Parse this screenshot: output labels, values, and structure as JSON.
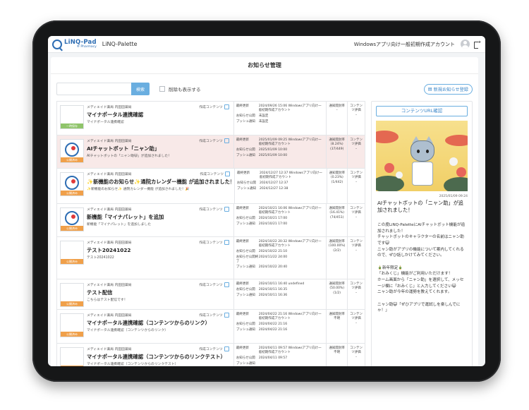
{
  "app": {
    "logo_main": "LiNQ-Pad",
    "logo_sub": "® Pharmacy",
    "name": "LiNQ-Palette",
    "account": "Windowsアプリ向け一般初期作成アカウント"
  },
  "page": {
    "title": "お知らせ管理",
    "search_button": "検索",
    "show_deleted_label": "削除も表示する",
    "new_button": "新規お知らせ登録"
  },
  "labels": {
    "content_type": "作成コンテンツ",
    "last_updated": "最終更新",
    "notice_public": "お知らせ公開",
    "push_notification": "プッシュ通知",
    "notice_end": "お知らせ公開終了",
    "read_rate": "通知開封率",
    "content_rating": "コンテンツ評価"
  },
  "notices": [
    {
      "pharmacy": "メディエイド薬局 内田田薬局",
      "title": "マイナポータル連携確認",
      "desc": "マイナポータル連携確認",
      "status": "一時保存",
      "status_color": "green",
      "has_logo": false,
      "updated": "2024/09/26 15:06 Windowsアプリ向け一般初期作成アカウント",
      "public": "未設定",
      "push": "未設定",
      "read_rate": "–",
      "rating": "–"
    },
    {
      "pharmacy": "メディエイド薬局 内田田薬局",
      "title": "AIチャットボット「ニャン助」",
      "desc": "AIチャットボットの「ニャン助😺」が追加されました！",
      "status": "公開済み",
      "status_color": "orange",
      "has_logo": true,
      "updated": "2025/01/09 09:25 Windowsアプリ向け一般初期作成アカウント",
      "public": "2025/01/09 10:00",
      "push": "2025/01/09 10:00",
      "read_rate": "(8.24%) (37/449)",
      "rating": "–"
    },
    {
      "pharmacy": "メディエイド薬局 内田田薬局",
      "title": "✨新機能のお知らせ✨通院カレンダー機能 が追加されました！",
      "desc": "✨新機能のお知らせ✨ 通院カレンダー機能 が追加されました！🎉",
      "status": "公開済み",
      "status_color": "orange",
      "has_logo": true,
      "updated": "2024/12/27 12:37 Windowsアプリ向け一般初期作成アカウント",
      "public": "2024/12/27 12:37",
      "push": "2024/12/27 12:38",
      "read_rate": "(0.23%) (1/442)",
      "rating": "–"
    },
    {
      "pharmacy": "メディエイド薬局 内田田薬局",
      "title": "新機能「マイナパレット」を追加",
      "desc": "新機能「マイナパレット」を追加しました",
      "status": "公開済み",
      "status_color": "orange",
      "has_logo": true,
      "updated": "2024/10/21 16:06 Windowsアプリ向け一般初期作成アカウント",
      "public": "2024/10/21 17:00",
      "push": "2024/10/21 17:00",
      "read_rate": "(16.41%) (74/451)",
      "rating": "–"
    },
    {
      "pharmacy": "メディエイド薬局 内田田薬局",
      "title": "テスト20241022",
      "desc": "テスト20241022",
      "status": "公開済み",
      "status_color": "orange",
      "has_logo": false,
      "updated": "2024/10/22 20:32 Windowsアプリ向け一般初期作成アカウント",
      "public": "2024/10/22 21:10",
      "end": "2024/11/22 24:00",
      "push": "2024/10/22 20:40",
      "read_rate": "(100.00%) (2/2)",
      "rating": "–"
    },
    {
      "pharmacy": "メディエイド薬局 内田田薬局",
      "title": "テスト配信",
      "desc": "こちらはテスト配信です！",
      "status": "公開済み",
      "status_color": "orange",
      "has_logo": false,
      "updated": "2024/10/11 16:40 undefined",
      "public": "2024/10/11 16:35",
      "push": "2024/10/11 16:36",
      "read_rate": "(50.00%) (1/2)",
      "rating": "–"
    },
    {
      "pharmacy": "メディエイド薬局 内田田薬局",
      "title": "マイナポータル連携確認（コンテンツからのリンク）",
      "desc": "マイナポータル連携確認（コンテンツからのリンク）",
      "status": "公開済み",
      "status_color": "orange",
      "has_logo": false,
      "updated": "2024/04/22 21:16 Windowsアプリ向け一般初期作成アカウント",
      "public": "2024/04/22 21:16",
      "push": "2024/04/22 21:16",
      "read_rate": "不明",
      "rating": "–"
    },
    {
      "pharmacy": "メディエイド薬局 内田田薬局",
      "title": "マイナポータル連携確認（コンテンツからのリンクテスト）",
      "desc": "マイナポータル連携確認（コンテンツからのリンクテスト）",
      "status": "公開済み",
      "status_color": "orange",
      "has_logo": false,
      "updated": "2024/04/11 09:57 Windowsアプリ向け一般初期作成アカウント",
      "public": "2024/04/11 09:57",
      "push": "",
      "read_rate": "不明",
      "rating": "–"
    }
  ],
  "preview": {
    "url_button": "コンテンツURL確認",
    "date": "2025/01/09 09:24",
    "title": "AIチャットボットの「ニャン助」が追加されました！",
    "body": "この度LiNQ-PaletteにAIチャットボット機能が追加されました！\nチャットボットのキャラクターの名前はニャン助です😺\nニャン助がアプリの機能について案内してくれるので、ぜひ話しかけてみてください。\n\n🎍新年限定🎍\n「おみくじ」機能がご利用いただけます！\nホーム画面から「ニャン助」を選択して、メッセージ欄に「おみくじ」と入力してください😺\nニャン助が今年の運勢を教えてくれます。\n\nニャン助😺「ぜひアプリで運試しを楽しんでにゃ！」"
  }
}
